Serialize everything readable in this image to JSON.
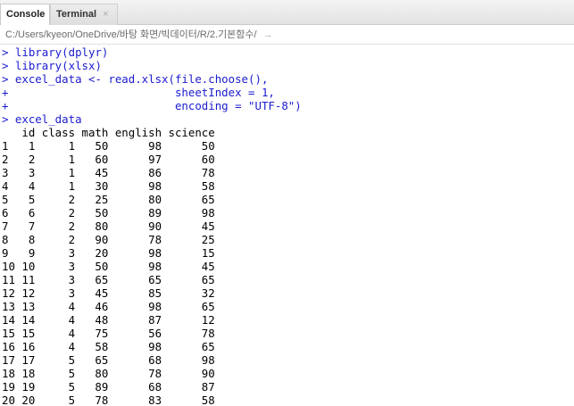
{
  "tabs": {
    "console_label": "Console",
    "terminal_label": "Terminal",
    "terminal_close": "×"
  },
  "path": {
    "text": "C:/Users/kyeon/OneDrive/바탕 화면/빅데이터/R/2.기본함수/",
    "goto_icon": "→"
  },
  "console": {
    "lines": [
      {
        "type": "cmd",
        "prompt": ">",
        "text": " library(dplyr)"
      },
      {
        "type": "cmd",
        "prompt": ">",
        "text": " library(xlsx)"
      },
      {
        "type": "cmd",
        "prompt": ">",
        "text": " excel_data <- read.xlsx(file.choose(),"
      },
      {
        "type": "cmd",
        "prompt": "+",
        "text": "                         sheetIndex = 1,"
      },
      {
        "type": "cmd",
        "prompt": "+",
        "text": "                         encoding = \"UTF-8\")"
      },
      {
        "type": "cmd",
        "prompt": ">",
        "text": " excel_data"
      },
      {
        "type": "out",
        "text": "   id class math english science"
      },
      {
        "type": "out",
        "text": "1   1     1   50      98      50"
      },
      {
        "type": "out",
        "text": "2   2     1   60      97      60"
      },
      {
        "type": "out",
        "text": "3   3     1   45      86      78"
      },
      {
        "type": "out",
        "text": "4   4     1   30      98      58"
      },
      {
        "type": "out",
        "text": "5   5     2   25      80      65"
      },
      {
        "type": "out",
        "text": "6   6     2   50      89      98"
      },
      {
        "type": "out",
        "text": "7   7     2   80      90      45"
      },
      {
        "type": "out",
        "text": "8   8     2   90      78      25"
      },
      {
        "type": "out",
        "text": "9   9     3   20      98      15"
      },
      {
        "type": "out",
        "text": "10 10     3   50      98      45"
      },
      {
        "type": "out",
        "text": "11 11     3   65      65      65"
      },
      {
        "type": "out",
        "text": "12 12     3   45      85      32"
      },
      {
        "type": "out",
        "text": "13 13     4   46      98      65"
      },
      {
        "type": "out",
        "text": "14 14     4   48      87      12"
      },
      {
        "type": "out",
        "text": "15 15     4   75      56      78"
      },
      {
        "type": "out",
        "text": "16 16     4   58      98      65"
      },
      {
        "type": "out",
        "text": "17 17     5   65      68      98"
      },
      {
        "type": "out",
        "text": "18 18     5   80      78      90"
      },
      {
        "type": "out",
        "text": "19 19     5   89      68      87"
      },
      {
        "type": "out",
        "text": "20 20     5   78      83      58"
      }
    ]
  },
  "colors": {
    "command": "#1b1bd0",
    "output": "#000000"
  }
}
